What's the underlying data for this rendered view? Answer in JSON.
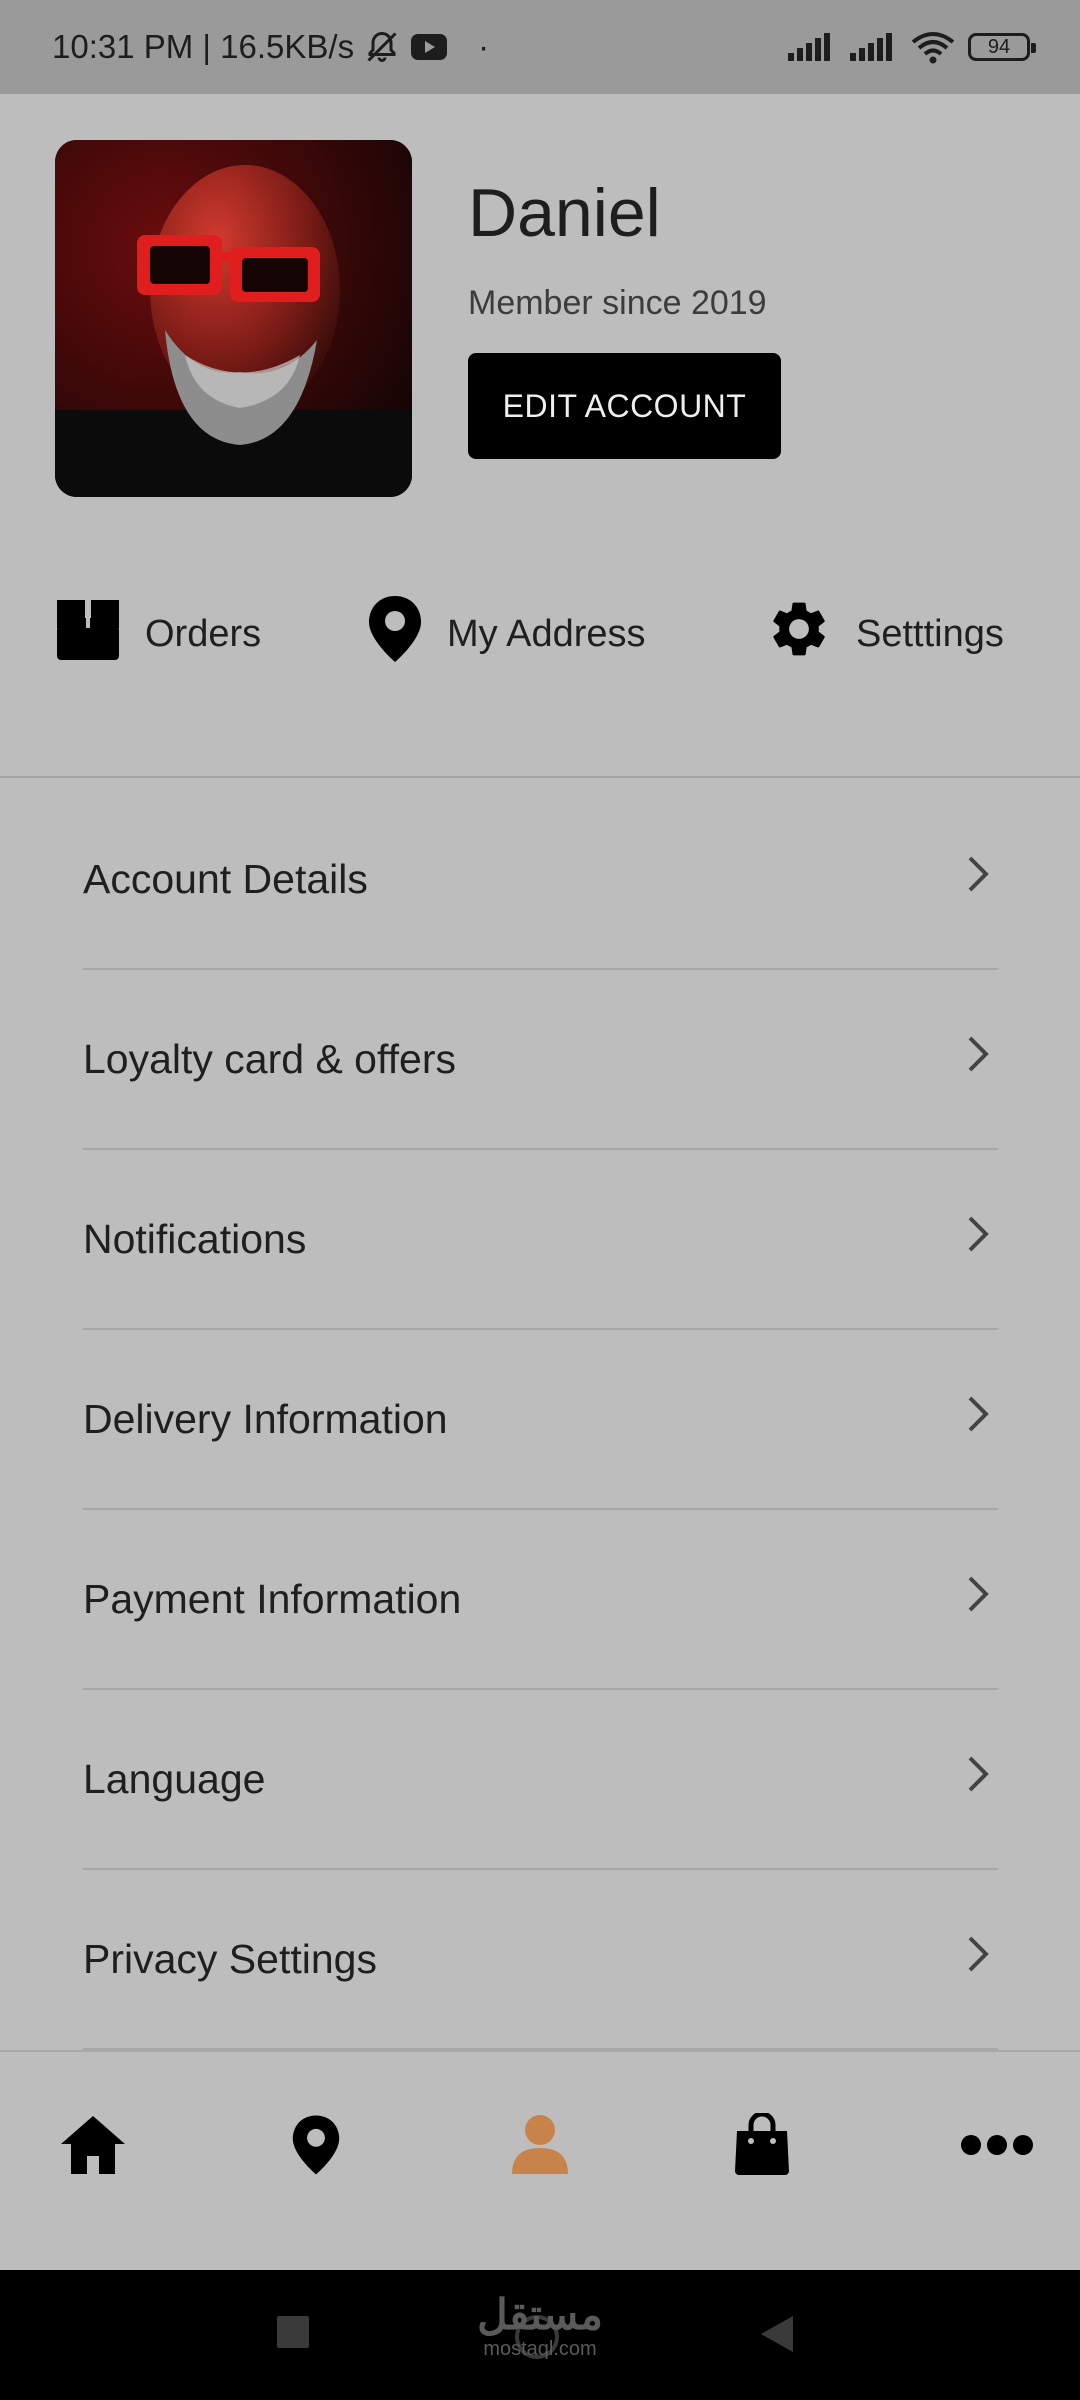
{
  "status_bar": {
    "time_speed": "10:31 PM | 16.5KB/s",
    "dot": "·",
    "battery": "94"
  },
  "profile": {
    "name": "Daniel",
    "member_since": "Member since 2019",
    "edit_button": "EDIT ACCOUNT"
  },
  "quick_actions": [
    {
      "label": "Orders",
      "icon": "box-icon"
    },
    {
      "label": "My Address",
      "icon": "location-pin-icon"
    },
    {
      "label": "Setttings",
      "icon": "gear-icon"
    }
  ],
  "menu": [
    {
      "label": "Account Details"
    },
    {
      "label": "Loyalty card & offers"
    },
    {
      "label": "Notifications"
    },
    {
      "label": "Delivery Information"
    },
    {
      "label": "Payment Information"
    },
    {
      "label": "Language"
    },
    {
      "label": "Privacy Settings"
    }
  ],
  "bottom_nav": [
    {
      "icon": "home-icon"
    },
    {
      "icon": "location-pin-icon"
    },
    {
      "icon": "person-icon",
      "active": true
    },
    {
      "icon": "shopping-bag-icon"
    },
    {
      "icon": "more-icon"
    }
  ],
  "colors": {
    "active_nav": "#c7834a",
    "background": "#bdbdbd"
  },
  "watermark": {
    "arabic": "مستقل",
    "latin": "mostaql.com"
  }
}
